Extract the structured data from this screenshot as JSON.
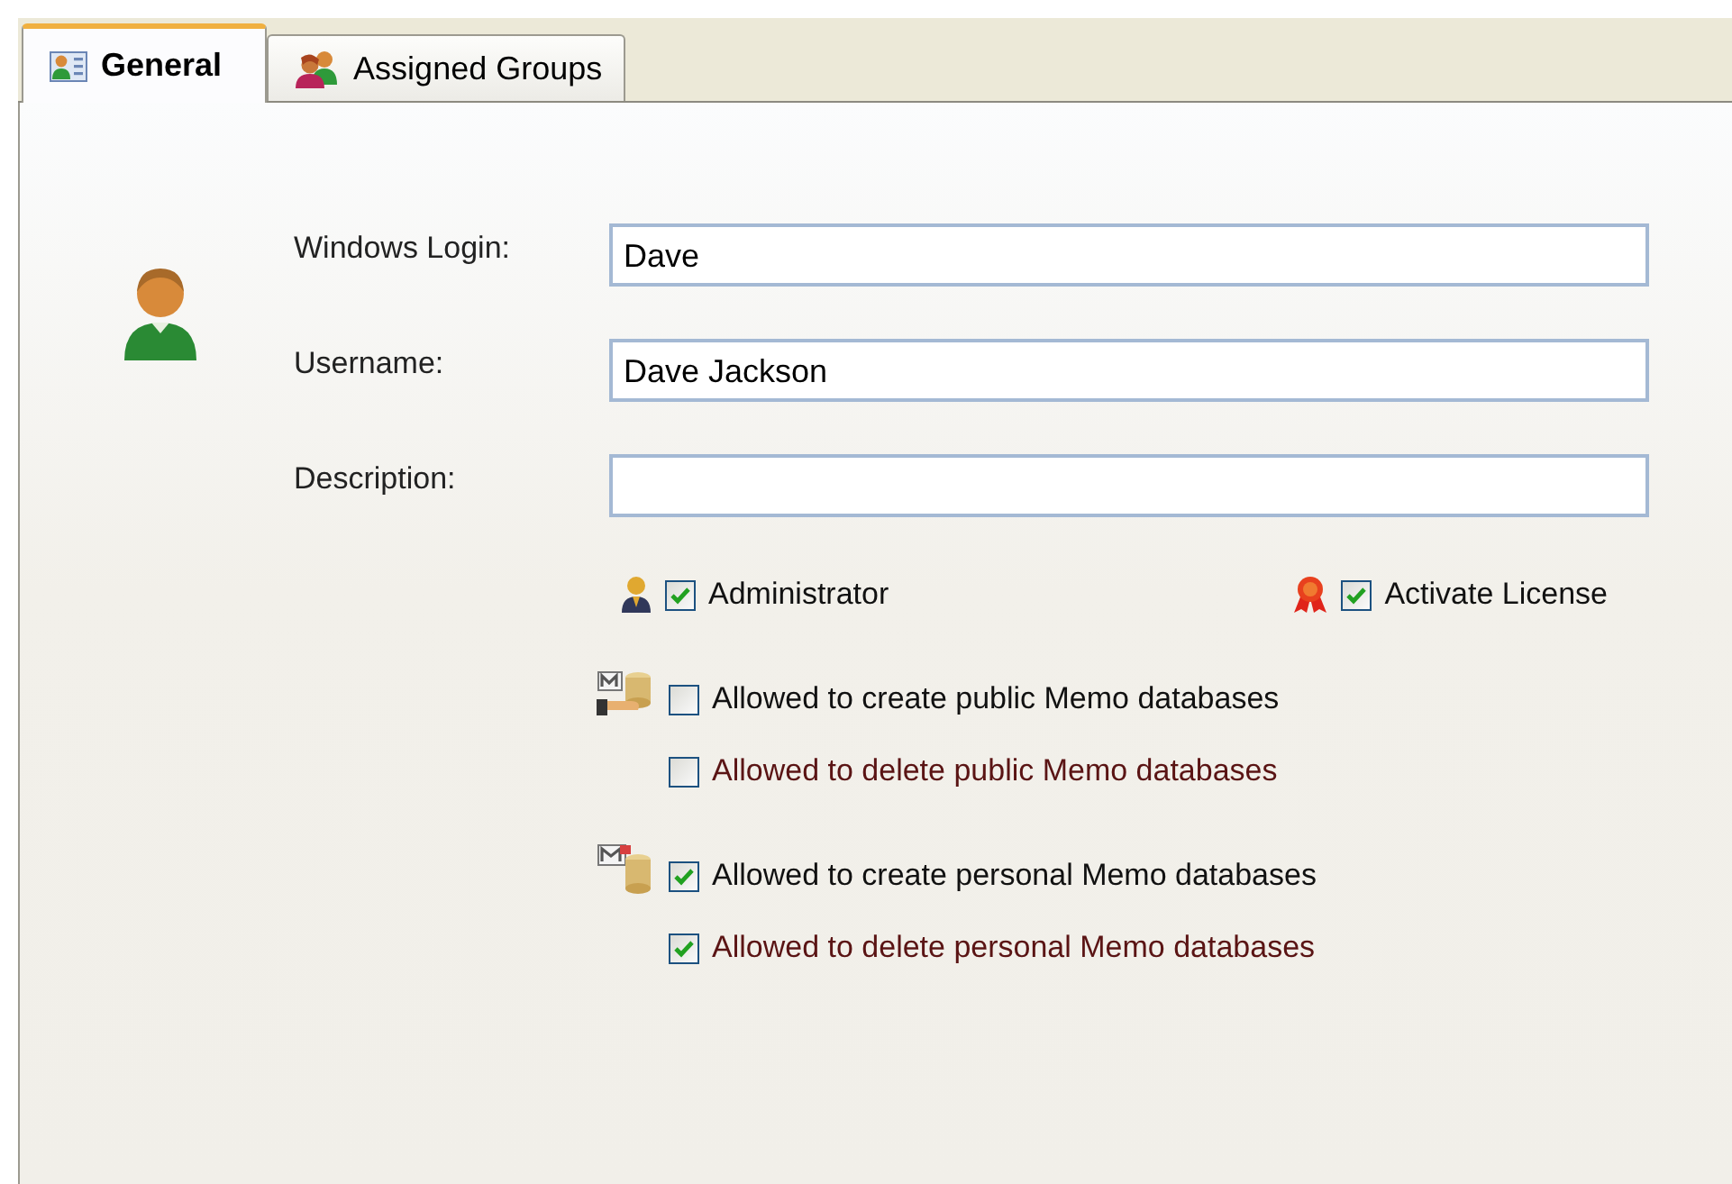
{
  "tabs": [
    {
      "label": "General",
      "selected": true
    },
    {
      "label": "Assigned Groups",
      "selected": false
    }
  ],
  "fields": [
    {
      "label": "Windows Login:",
      "value": "Dave"
    },
    {
      "label": "Username:",
      "value": "Dave Jackson"
    },
    {
      "label": "Description:"
    }
  ],
  "flags": [
    {
      "label": "Administrator",
      "checked": true
    },
    {
      "label": "Activate License",
      "checked": true
    }
  ],
  "permission_groups": [
    {
      "items": [
        {
          "label": "Allowed to create public Memo databases",
          "checked": false,
          "kind": "create"
        },
        {
          "label": "Allowed to delete public Memo databases",
          "checked": false,
          "kind": "delete"
        }
      ]
    },
    {
      "items": [
        {
          "label": "Allowed to create personal Memo databases",
          "checked": true,
          "kind": "create"
        },
        {
          "label": "Allowed to delete personal Memo databases",
          "checked": true,
          "kind": "delete"
        }
      ]
    }
  ]
}
